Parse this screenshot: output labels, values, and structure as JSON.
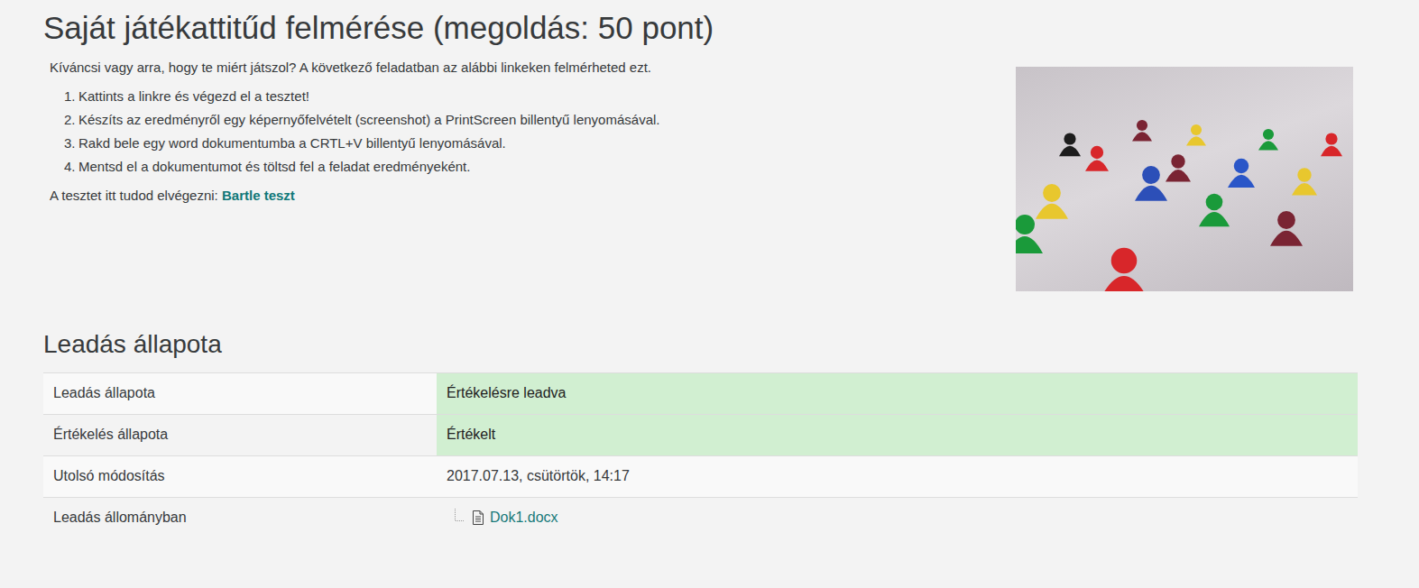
{
  "page": {
    "title": "Saját játékattitűd felmérése (megoldás: 50 pont)"
  },
  "intro": "Kíváncsi vagy arra, hogy te miért játszol? A következő feladatban az alábbi linkeken felmérheted ezt.",
  "steps": [
    {
      "number": "1.",
      "text": "Kattints a linkre és végezd el a tesztet!"
    },
    {
      "number": "2.",
      "text": "Készíts az eredményről egy képernyőfelvételt (screenshot) a PrintScreen billentyű lenyomásával."
    },
    {
      "number": "3.",
      "text": "Rakd bele egy word dokumentumba a CRTL+V billentyű lenyomásával."
    },
    {
      "number": "4.",
      "text": "Mentsd el a dokumentumot és töltsd fel a feladat eredményeként."
    }
  ],
  "test_link": {
    "prefix": "A tesztet itt tudod elvégezni:",
    "label": "Bartle teszt"
  },
  "status": {
    "heading": "Leadás állapota",
    "rows": [
      {
        "label": "Leadás állapota",
        "value": "Értékelésre leadva",
        "kind": "text",
        "highlighted": true
      },
      {
        "label": "Értékelés állapota",
        "value": "Értékelt",
        "kind": "text",
        "highlighted": true
      },
      {
        "label": "Utolsó módosítás",
        "value": "2017.07.13, csütörtök, 14:17",
        "kind": "text",
        "highlighted": false
      },
      {
        "label": "Leadás állományban",
        "value": "Dok1.docx",
        "kind": "file",
        "highlighted": false
      }
    ]
  }
}
